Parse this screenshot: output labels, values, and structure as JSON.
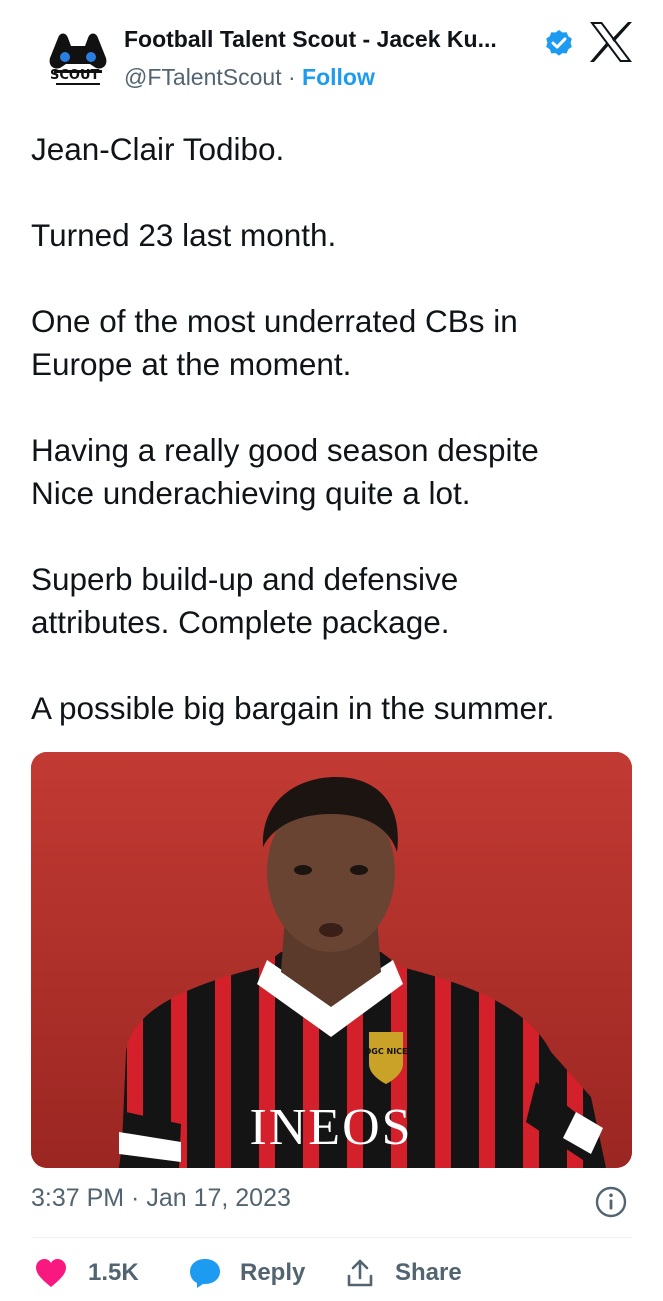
{
  "header": {
    "display_name": "Football Talent Scout - Jacek Ku...",
    "handle": "@FTalentScout",
    "separator": "·",
    "follow_label": "Follow",
    "avatar_text": "SCOUT"
  },
  "tweet": {
    "paragraphs": [
      [
        "Jean-Clair Todibo."
      ],
      [
        "Turned 23 last month."
      ],
      [
        "One of the most underrated CBs in",
        "Europe at the moment."
      ],
      [
        "Having a really good season despite",
        "Nice underachieving quite a lot."
      ],
      [
        "Superb build-up and defensive",
        "attributes. Complete package."
      ],
      [
        "A possible big bargain in the summer."
      ]
    ]
  },
  "media": {
    "shirt_sponsor": "INEOS",
    "crest_text": "OGC NICE"
  },
  "meta": {
    "timestamp": "3:37 PM · Jan 17, 2023"
  },
  "actions": {
    "likes": "1.5K",
    "reply_label": "Reply",
    "share_label": "Share"
  },
  "colors": {
    "accent": "#1d9bf0",
    "like": "#f91880",
    "muted": "#536471",
    "text": "#0f1419"
  },
  "icons": [
    "scout-logo-icon",
    "verified-badge-icon",
    "x-logo-icon",
    "info-icon",
    "heart-icon",
    "reply-bubble-icon",
    "share-icon"
  ]
}
